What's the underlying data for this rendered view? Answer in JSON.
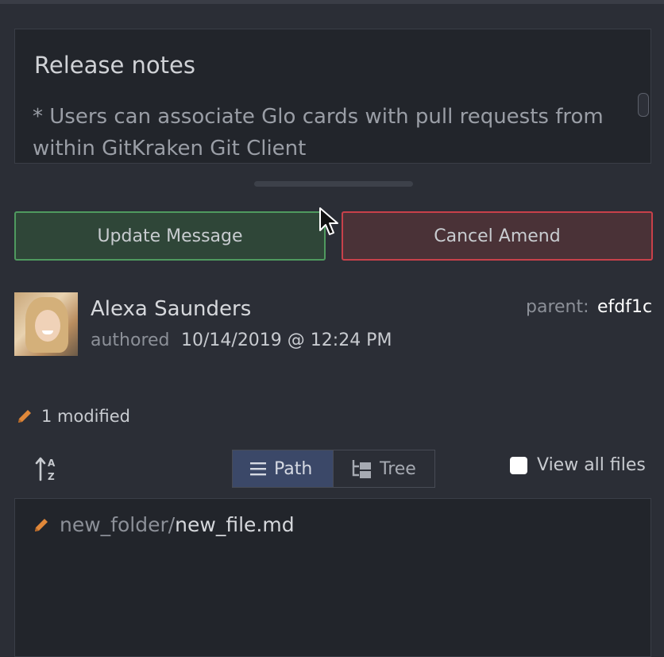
{
  "commit_message": {
    "summary": "Release notes",
    "description": "* Users can associate Glo cards with pull requests from within GitKraken Git Client"
  },
  "buttons": {
    "update_message": "Update Message",
    "cancel_amend": "Cancel Amend"
  },
  "author": {
    "name": "Alexa Saunders",
    "authored_label": "authored",
    "date": "10/14/2019 @ 12:24 PM",
    "parent_label": "parent:",
    "parent_hash": "efdf1c"
  },
  "changes": {
    "modified_count_text": "1 modified"
  },
  "view_toggle": {
    "path_label": "Path",
    "tree_label": "Tree",
    "selected": "Path"
  },
  "view_all_files": {
    "label": "View all files",
    "checked": false
  },
  "files": [
    {
      "folder": "new_folder/",
      "name": "new_file.md",
      "status": "modified"
    }
  ],
  "colors": {
    "background": "#2b2e36",
    "panel": "#22252b",
    "update_border": "#4f9a5f",
    "cancel_border": "#c8414a",
    "modified_icon": "#e0883a",
    "segment_active": "#3b4868"
  },
  "icons": {
    "modified": "pencil-icon",
    "sort": "sort-az-icon",
    "path": "list-icon",
    "tree": "tree-icon"
  }
}
